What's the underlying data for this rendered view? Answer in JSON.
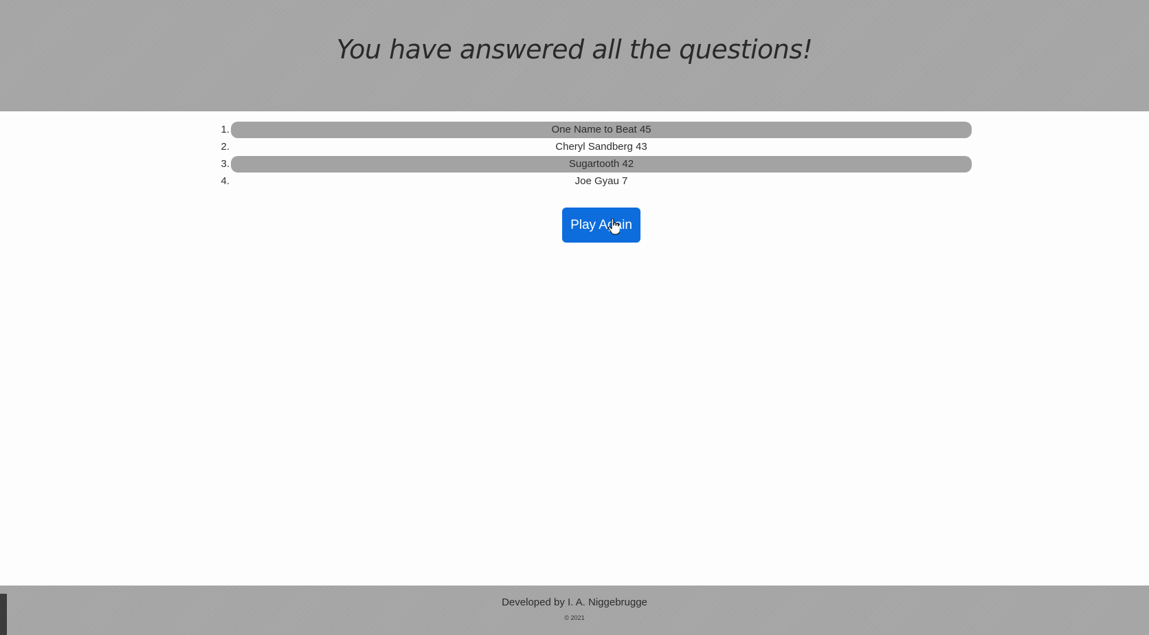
{
  "header": {
    "title": "You have answered all the questions!"
  },
  "scores": [
    {
      "rank": "1.",
      "text": "One Name to Beat 45",
      "shaded": true
    },
    {
      "rank": "2.",
      "text": "Cheryl Sandberg 43",
      "shaded": false
    },
    {
      "rank": "3.",
      "text": "Sugartooth 42",
      "shaded": true
    },
    {
      "rank": "4.",
      "text": "Joe Gyau 7",
      "shaded": false
    }
  ],
  "actions": {
    "play_again_label": "Play Again"
  },
  "footer": {
    "developer": "Developed by I. A. Niggebrugge",
    "copyright": "© 2021"
  },
  "colors": {
    "header_bg": "#a7a7a7",
    "button_bg": "#0d6ddc",
    "shaded_row_bg": "#a3a3a3"
  }
}
